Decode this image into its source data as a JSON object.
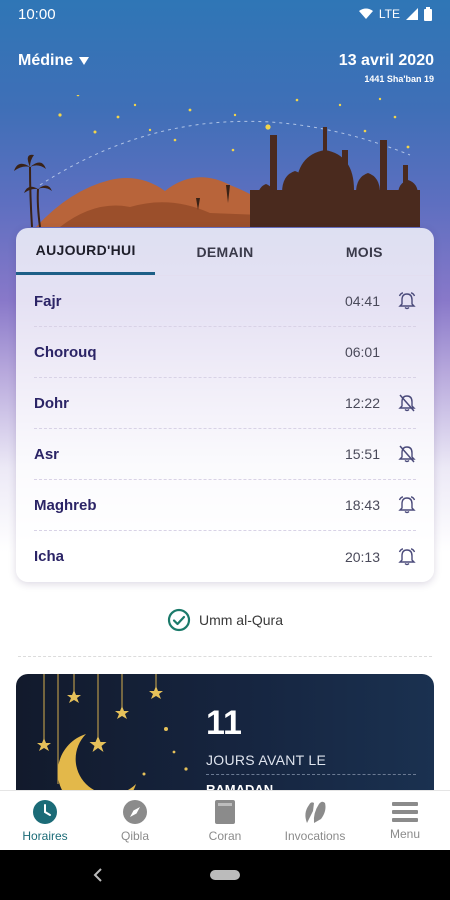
{
  "status": {
    "time": "10:00",
    "network": "LTE"
  },
  "header": {
    "city": "Médine",
    "gregorian_date": "13 avril 2020",
    "hijri_date": "1441 Sha'ban 19"
  },
  "tabs": [
    "AUJOURD'HUI",
    "DEMAIN",
    "MOIS"
  ],
  "prayers": [
    {
      "name": "Fajr",
      "time": "04:41",
      "alarm": "on"
    },
    {
      "name": "Chorouq",
      "time": "06:01",
      "alarm": "none"
    },
    {
      "name": "Dohr",
      "time": "12:22",
      "alarm": "off"
    },
    {
      "name": "Asr",
      "time": "15:51",
      "alarm": "off"
    },
    {
      "name": "Maghreb",
      "time": "18:43",
      "alarm": "on"
    },
    {
      "name": "Icha",
      "time": "20:13",
      "alarm": "on"
    }
  ],
  "calculation_method": "Umm al-Qura",
  "promo": {
    "count": "11",
    "text": "JOURS AVANT LE",
    "subtitle": "RAMADAN"
  },
  "nav": [
    {
      "label": "Horaires",
      "icon": "clock-icon"
    },
    {
      "label": "Qibla",
      "icon": "compass-icon"
    },
    {
      "label": "Coran",
      "icon": "book-icon"
    },
    {
      "label": "Invocations",
      "icon": "hands-icon"
    },
    {
      "label": "Menu",
      "icon": "menu-icon"
    }
  ],
  "colors": {
    "accent": "#1b6b77",
    "prayer_name": "#2b2466",
    "tab_indicator": "#1d5f87"
  }
}
